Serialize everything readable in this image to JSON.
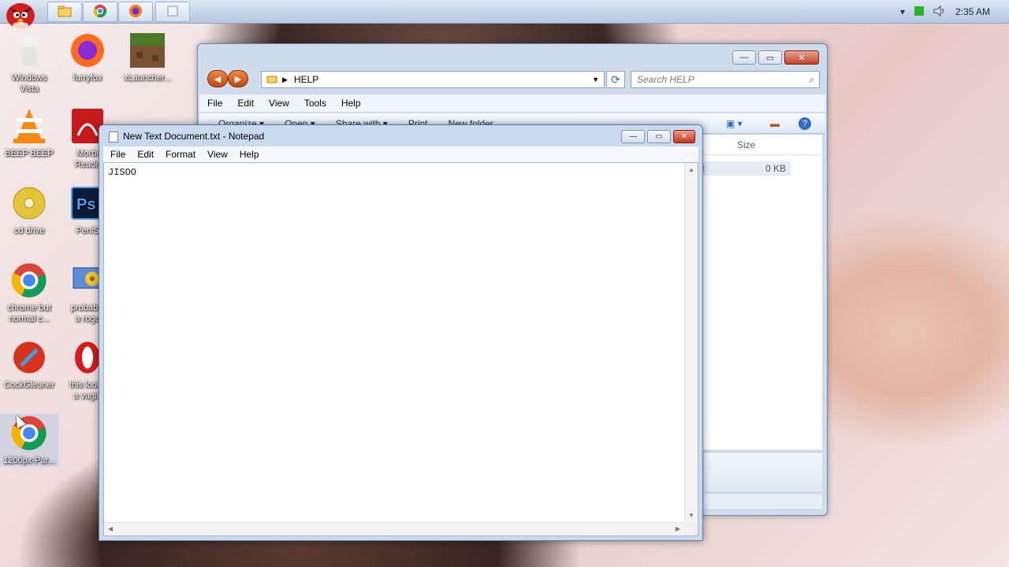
{
  "taskbar": {
    "pinned": [
      "explorer-icon",
      "chrome-icon",
      "firefox-icon",
      "window-icon"
    ],
    "tray": {
      "chevron": "▾",
      "clock": "2:35 AM"
    }
  },
  "desktop_icons": [
    {
      "name": "windows-vista",
      "label1": "Windows",
      "label2": "Vista"
    },
    {
      "name": "furryfox",
      "label1": "furryfox",
      "label2": ""
    },
    {
      "name": "xlauncher",
      "label1": "xLauncher...",
      "label2": ""
    },
    {
      "name": "beep-beep",
      "label1": "BEEP BEEP",
      "label2": ""
    },
    {
      "name": "morbid-reader",
      "label1": "Morbi",
      "label2": "Reade"
    },
    {
      "name": "cd-drive",
      "label1": "cd drive",
      "label2": ""
    },
    {
      "name": "penis",
      "label1": "PeniS",
      "label2": ""
    },
    {
      "name": "chrome-but-normal",
      "label1": "chrome but",
      "label2": "normal c..."
    },
    {
      "name": "probably-a-rogue",
      "label1": "probably",
      "label2": "a rogu"
    },
    {
      "name": "cockgleaner",
      "label1": "CockGleaner",
      "label2": ""
    },
    {
      "name": "this-looks-a-vagina",
      "label1": "this looks",
      "label2": "a vagin"
    },
    {
      "name": "1200px-par",
      "label1": "1200px-Par...",
      "label2": ""
    }
  ],
  "explorer": {
    "address": "HELP",
    "search_placeholder": "Search HELP",
    "menu": [
      "File",
      "Edit",
      "View",
      "Tools",
      "Help"
    ],
    "toolbar": [
      "Organize ▾",
      "Open ▾",
      "Share with ▾",
      "Print",
      "New folder"
    ],
    "column_size": "Size",
    "row_size": "0 KB",
    "row_type_fragment": "t"
  },
  "notepad": {
    "title": "New Text Document.txt - Notepad",
    "menu": [
      "File",
      "Edit",
      "Format",
      "View",
      "Help"
    ],
    "content": "JISOO"
  }
}
